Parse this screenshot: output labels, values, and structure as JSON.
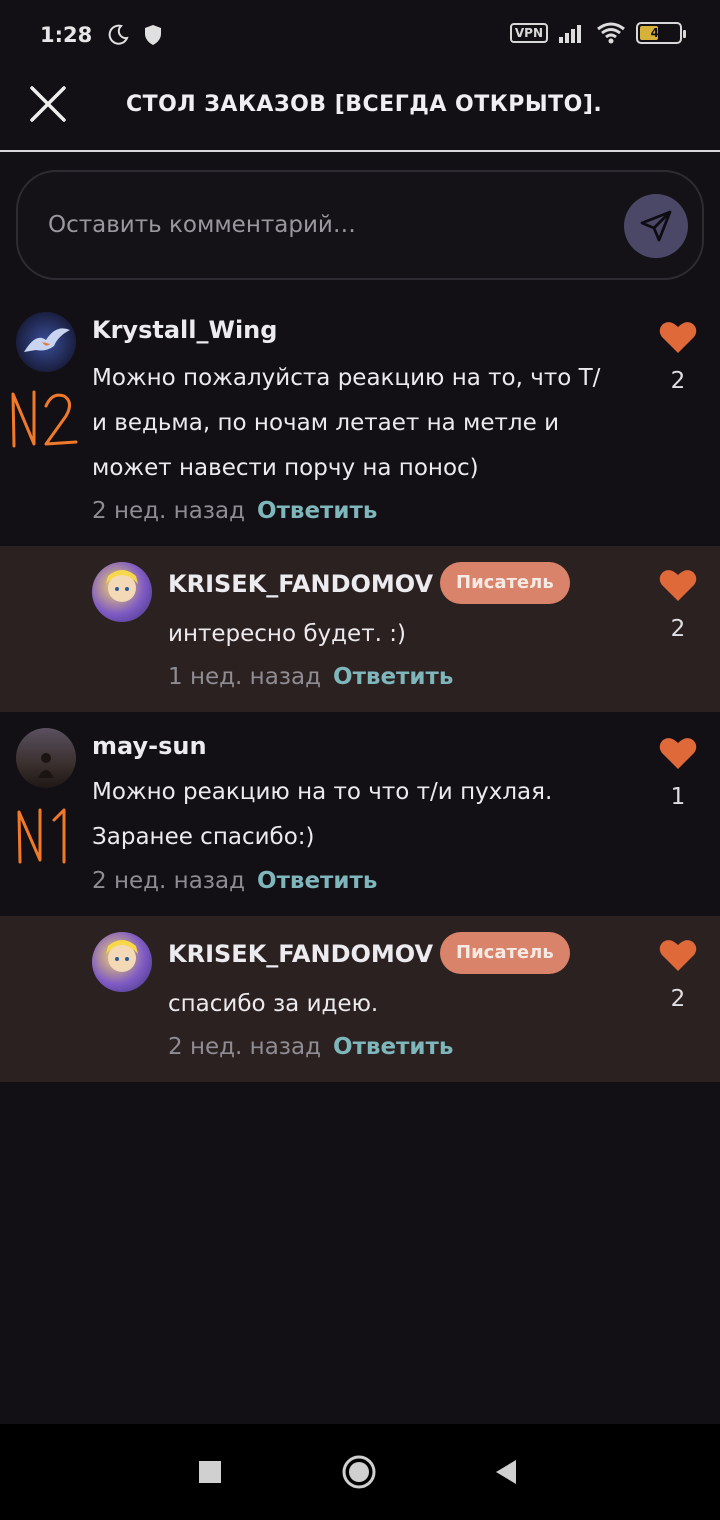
{
  "status_bar": {
    "time": "1:28",
    "vpn": "VPN",
    "battery": "47",
    "battery_level": 0.47
  },
  "header": {
    "title": "СТОЛ ЗАКАЗОВ [ВСЕГДА ОТКРЫТО]."
  },
  "comment_input": {
    "placeholder": "Оставить комментарий…"
  },
  "comments": [
    {
      "username": "Krystall_Wing",
      "text_lines": [
        "Можно пожалуйста реакцию на то, что Т/",
        "и ведьма, по ночам летает на метле и",
        "может навести порчу на понос)"
      ],
      "time": "2 нед. назад",
      "reply_label": "Ответить",
      "likes": "2",
      "annotation": "N2"
    },
    {
      "username": "KRISEK_FANDOMOV",
      "badge": "Писатель",
      "text_lines": [
        "интересно будет. :)"
      ],
      "time": "1 нед. назад",
      "reply_label": "Ответить",
      "likes": "2"
    },
    {
      "username": "may-sun",
      "text_lines": [
        "Можно реакцию на то что т/и пухлая.",
        "Заранее спасибо:)"
      ],
      "time": "2 нед. назад",
      "reply_label": "Ответить",
      "likes": "1",
      "annotation": "N1"
    },
    {
      "username": "KRISEK_FANDOMOV",
      "badge": "Писатель",
      "text_lines": [
        "спасибо за идею."
      ],
      "time": "2 нед. назад",
      "reply_label": "Ответить",
      "likes": "2"
    }
  ],
  "colors": {
    "background": "#121014",
    "reply_background": "#2b2120",
    "heart": "#e0693a",
    "badge": "#d9846a",
    "reply_link": "#7fb6bb",
    "annotation": "#f07a2a"
  },
  "icons": {
    "close": "close-icon",
    "send": "send-icon",
    "like": "heart-icon"
  }
}
